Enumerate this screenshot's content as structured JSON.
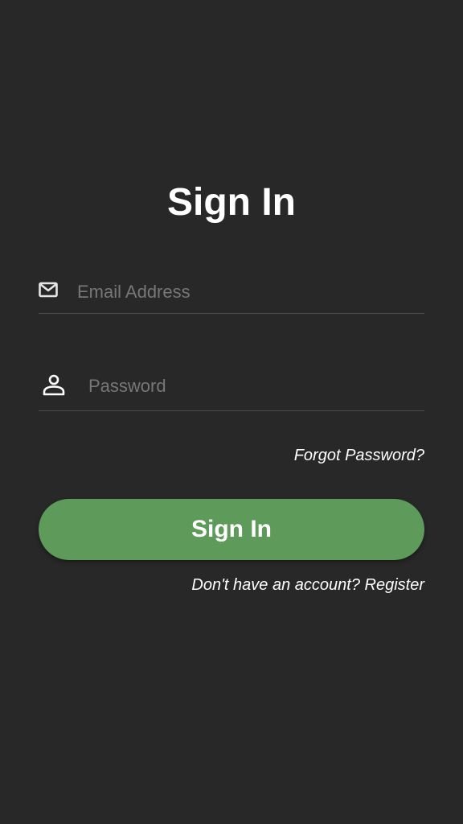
{
  "title": "Sign In",
  "email": {
    "placeholder": "Email Address",
    "value": "",
    "icon": "mail-icon"
  },
  "password": {
    "placeholder": "Password",
    "value": "",
    "icon": "person-icon"
  },
  "forgot_password": "Forgot Password?",
  "signin_button": "Sign In",
  "register_prompt": "Don't have an account?",
  "register_link": "Register",
  "colors": {
    "background": "#282828",
    "accent": "#5e9a5a",
    "text": "#ffffff",
    "placeholder": "#777777",
    "divider": "#4c4c4c"
  }
}
